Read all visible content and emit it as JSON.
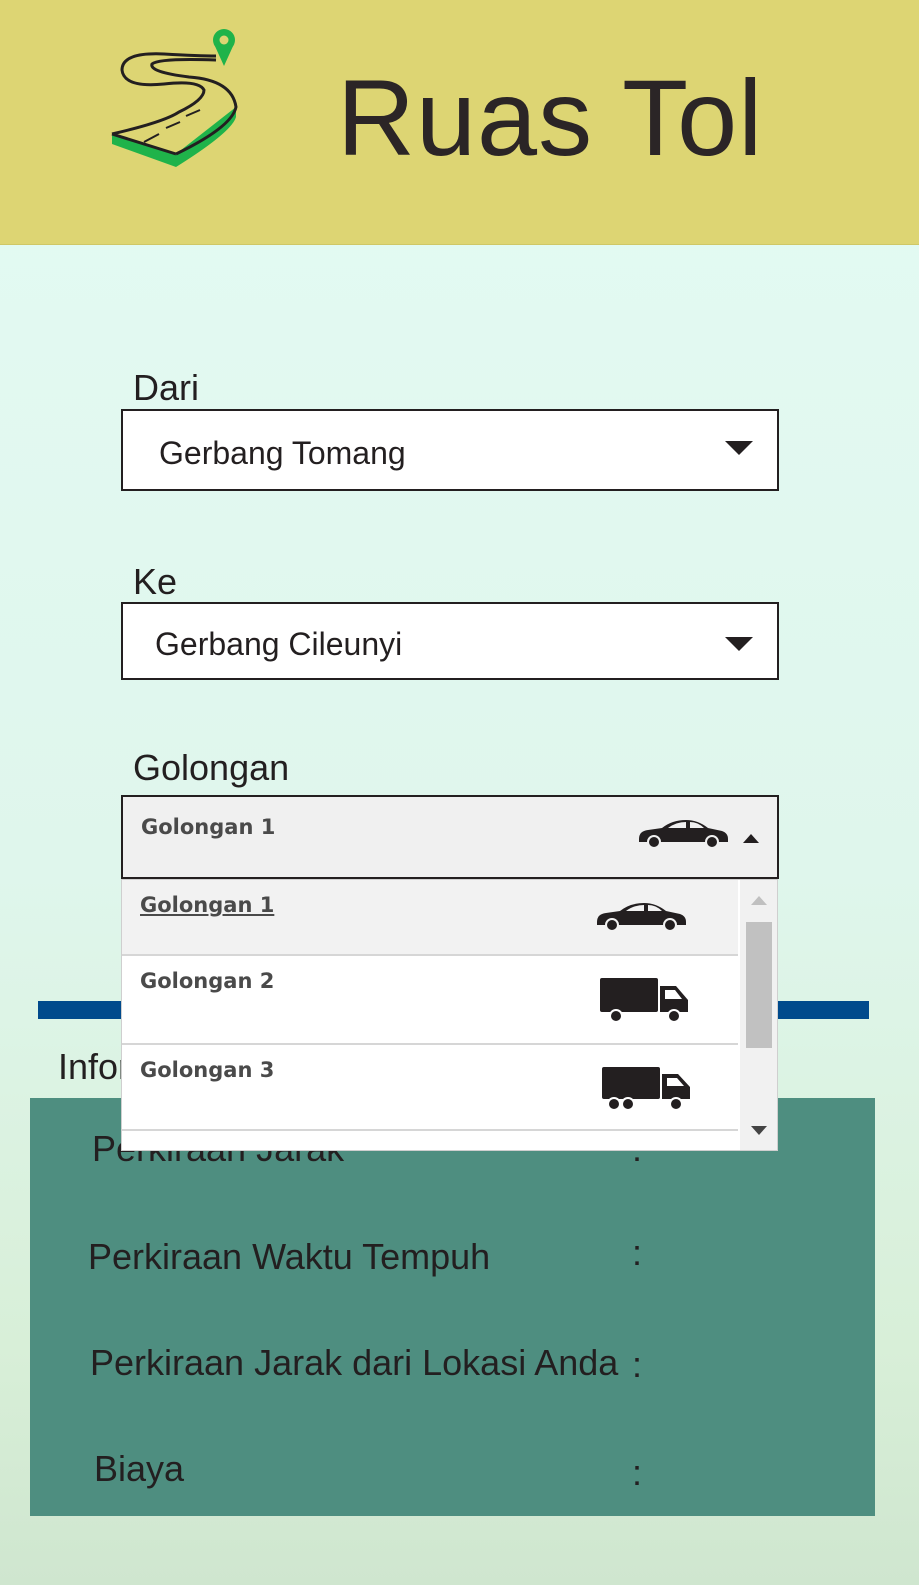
{
  "header": {
    "title": "Ruas Tol",
    "background": "#ddd573",
    "logo_icon": "road-pin-logo"
  },
  "form": {
    "from": {
      "label": "Dari",
      "value": "Gerbang Tomang"
    },
    "to": {
      "label": "Ke",
      "value": "Gerbang Cileunyi"
    },
    "class": {
      "label": "Golongan",
      "selected": "Golongan 1",
      "options": [
        {
          "label": "Golongan 1",
          "icon": "car-icon"
        },
        {
          "label": "Golongan 2",
          "icon": "truck-icon"
        },
        {
          "label": "Golongan 3",
          "icon": "truck-double-axle-icon"
        }
      ]
    }
  },
  "info": {
    "label": "Infor",
    "rows": [
      {
        "label": "Perkiraan Jarak",
        "colon": ":"
      },
      {
        "label": "Perkiraan Waktu Tempuh",
        "colon": ":"
      },
      {
        "label": "Perkiraan Jarak dari Lokasi Anda",
        "colon": ":"
      },
      {
        "label": "Biaya",
        "colon": ":"
      }
    ],
    "panel_color": "#4e8e80",
    "bar_color": "#004a8c"
  }
}
